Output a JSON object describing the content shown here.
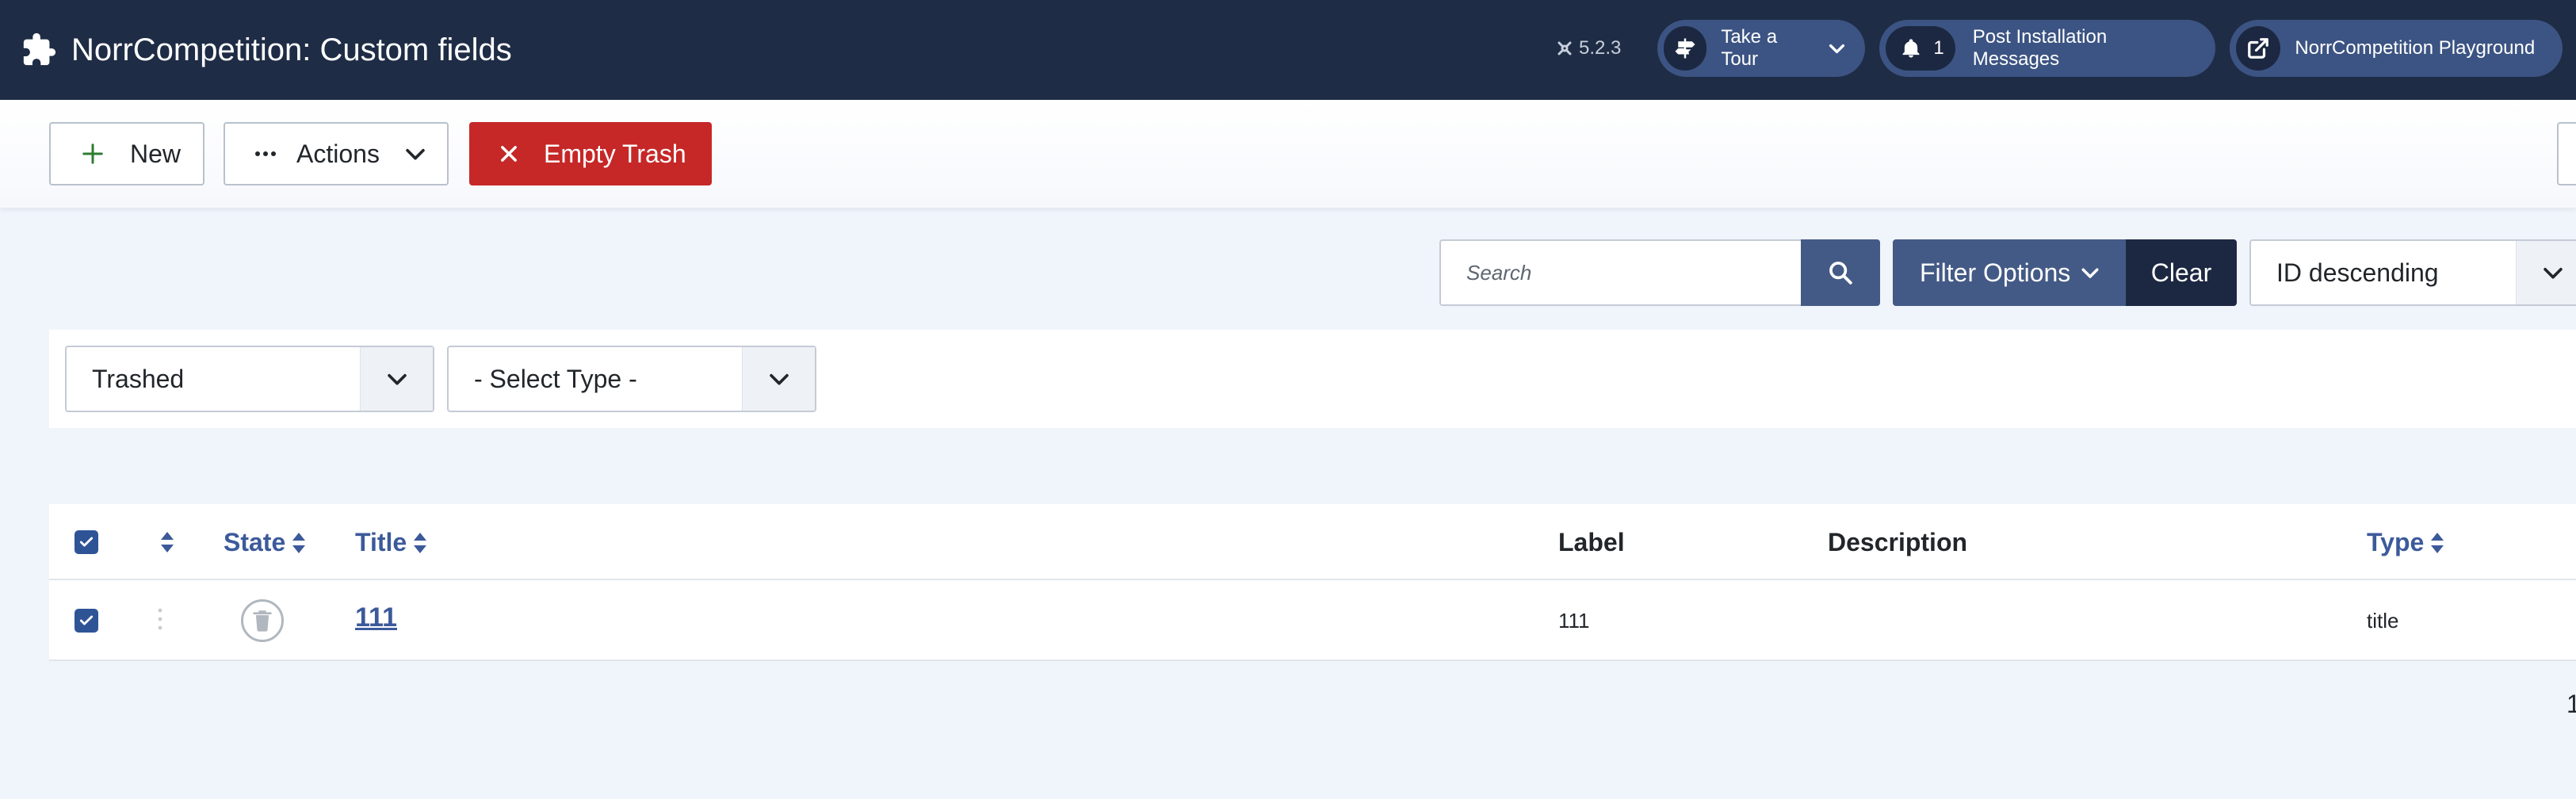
{
  "header": {
    "title": "NorrCompetition: Custom fields",
    "version": "5.2.3",
    "tour_label": "Take a Tour",
    "notification_count": "1",
    "messages_label": "Post Installation Messages",
    "site_label": "NorrCompetition Playground",
    "icons": {
      "app": "puzzle-icon",
      "version": "joomla-icon",
      "tour": "signpost-icon",
      "messages": "bell-icon",
      "site": "external-link-icon"
    }
  },
  "toolbar": {
    "new_label": "New",
    "actions_label": "Actions",
    "empty_trash_label": "Empty Trash"
  },
  "search": {
    "placeholder": "Search",
    "value": ""
  },
  "filters": {
    "options_label": "Filter Options",
    "clear_label": "Clear",
    "sort_value": "ID descending",
    "state_value": "Trashed",
    "type_value": "- Select Type -"
  },
  "table": {
    "columns": {
      "state": "State",
      "title": "Title",
      "label": "Label",
      "description": "Description",
      "type": "Type"
    },
    "rows": [
      {
        "checked": true,
        "state": "trashed",
        "title": "111",
        "label": "111",
        "description": "",
        "type": "title"
      }
    ]
  },
  "pagination": {
    "edge_text": "1"
  },
  "colors": {
    "header_bg": "#1f2c45",
    "accent": "#445a86",
    "danger": "#c52827",
    "link": "#3c5a9a"
  }
}
